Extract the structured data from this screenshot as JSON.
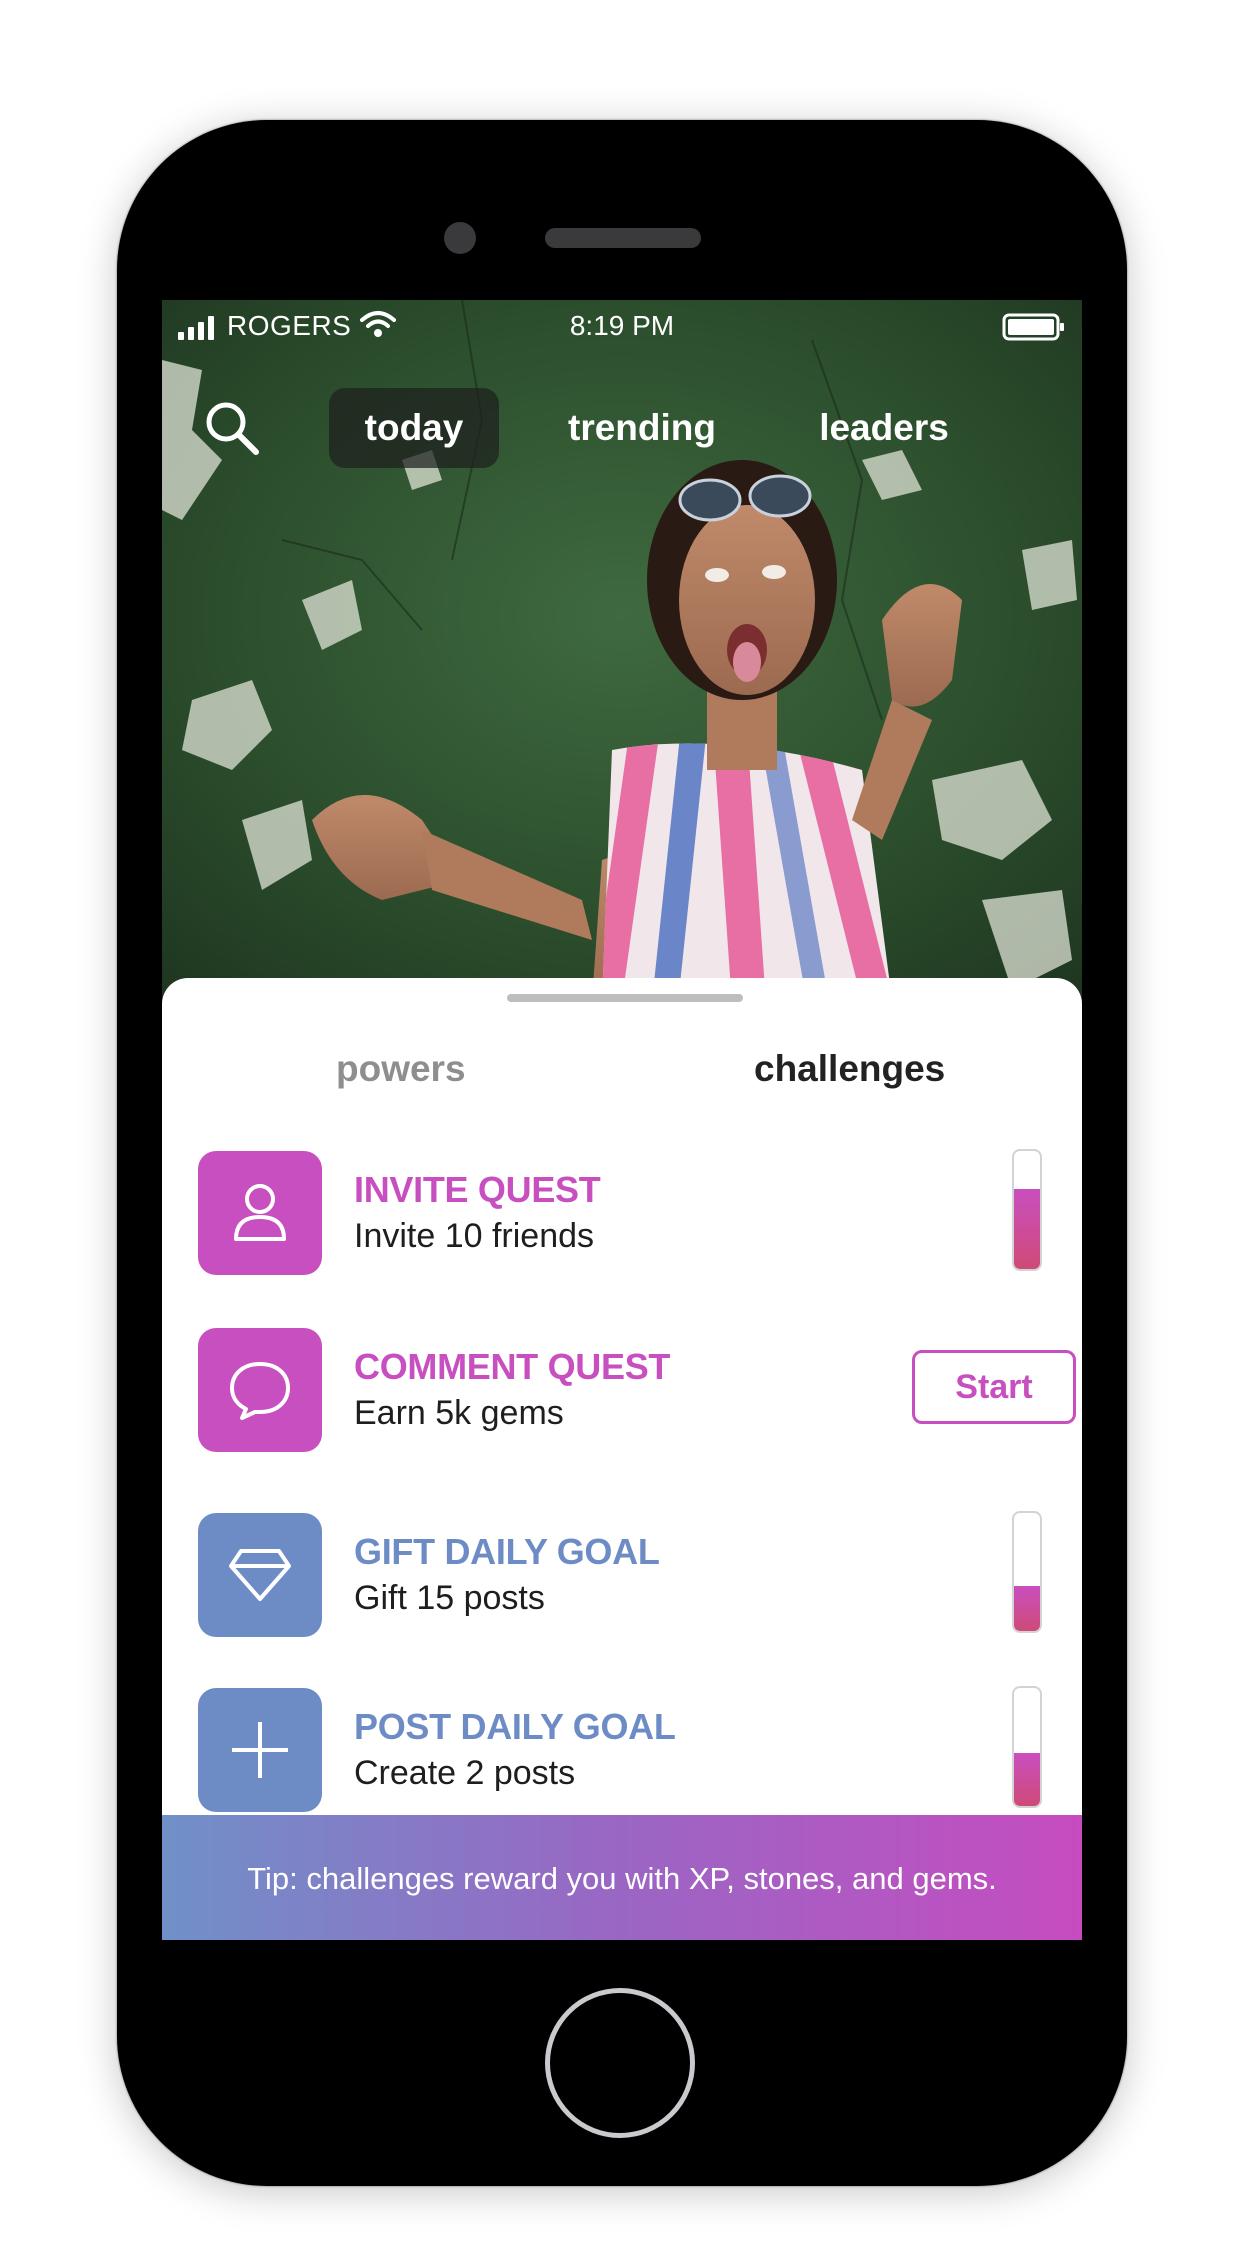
{
  "status_bar": {
    "carrier": "ROGERS",
    "time": "8:19 PM"
  },
  "top_nav": {
    "tabs": [
      {
        "label": "today",
        "active": true
      },
      {
        "label": "trending",
        "active": false
      },
      {
        "label": "leaders",
        "active": false
      }
    ],
    "search_icon": "search-icon"
  },
  "sheet": {
    "segments": [
      {
        "label": "powers",
        "active": false
      },
      {
        "label": "challenges",
        "active": true
      }
    ],
    "challenges": [
      {
        "title": "INVITE QUEST",
        "subtitle": "Invite 10 friends",
        "icon": "user-icon",
        "color": "#c84fbf",
        "progress": 0.68
      },
      {
        "title": "COMMENT QUEST",
        "subtitle": "Earn 5k gems",
        "icon": "speech-bubble-icon",
        "color": "#c84fbf",
        "action": "Start"
      },
      {
        "title": "GIFT DAILY GOAL",
        "subtitle": "Gift 15 posts",
        "icon": "diamond-icon",
        "color": "#6d8cc6",
        "progress": 0.38
      },
      {
        "title": "POST DAILY GOAL",
        "subtitle": "Create 2 posts",
        "icon": "plus-icon",
        "color": "#6d8cc6",
        "progress": 0.45
      }
    ]
  },
  "tip": "Tip: challenges reward you with XP, stones, and gems.",
  "colors": {
    "pink_accent": "#c84fbf",
    "blue_accent": "#6d8cc6",
    "gradient_start": "#7090c8",
    "gradient_end": "#c64cc0"
  }
}
